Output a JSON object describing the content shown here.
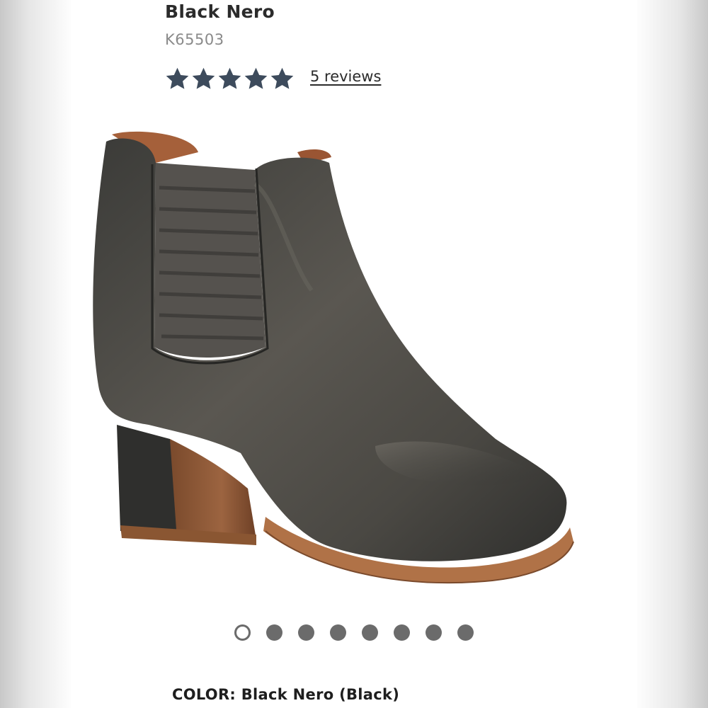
{
  "product": {
    "name": "Black Nero",
    "sku": "K65503",
    "rating": 5,
    "rating_max": 5,
    "reviews_label": "5 reviews",
    "star_color": "#3d4b5c",
    "image_icon": "ankle-boot-image"
  },
  "carousel": {
    "total": 8,
    "active_index": 0
  },
  "color": {
    "label": "COLOR:",
    "value": "Black Nero (Black)"
  }
}
